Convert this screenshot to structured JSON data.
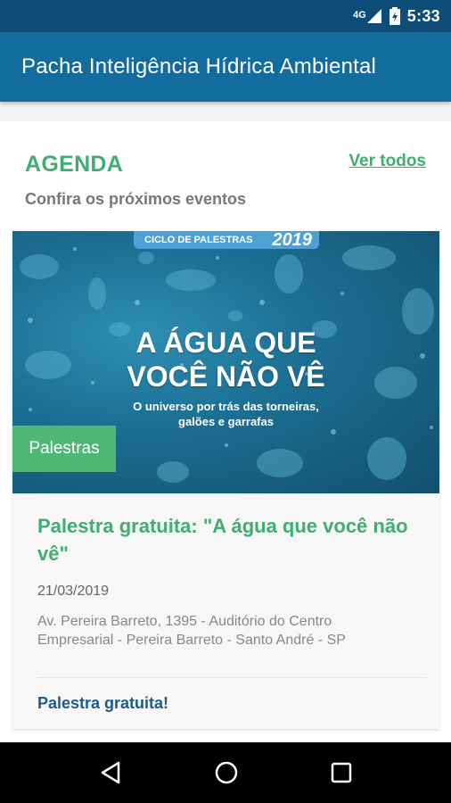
{
  "status_bar": {
    "network": "4G",
    "time": "5:33",
    "icons": [
      "signal-icon",
      "battery-charging-icon"
    ]
  },
  "app_bar": {
    "title": "Pacha Inteligência Hídrica Ambiental"
  },
  "agenda": {
    "heading": "AGENDA",
    "see_all": "Ver todos",
    "subtitle": "Confira os próximos eventos"
  },
  "event": {
    "banner": {
      "series": "CICLO DE PALESTRAS",
      "year": "2019",
      "headline_1": "A ÁGUA QUE",
      "headline_2": "VOCÊ NÃO VÊ",
      "tagline_1": "O universo por trás das torneiras,",
      "tagline_2": "galões e garrafas"
    },
    "category": "Palestras",
    "title": "Palestra gratuita: \"A água que você não vê\"",
    "date": "21/03/2019",
    "address": "Av. Pereira Barreto, 1395 - Auditório do Centro Empresarial - Pereira Barreto - Santo André - SP",
    "link": "Palestra gratuita!"
  },
  "colors": {
    "status_bar": "#0d4d78",
    "app_bar": "#136c9e",
    "accent_green": "#3fae6f",
    "link_blue": "#1d5b8a"
  },
  "nav_bar": {
    "icons": [
      "back-icon",
      "home-icon",
      "recents-icon"
    ]
  }
}
